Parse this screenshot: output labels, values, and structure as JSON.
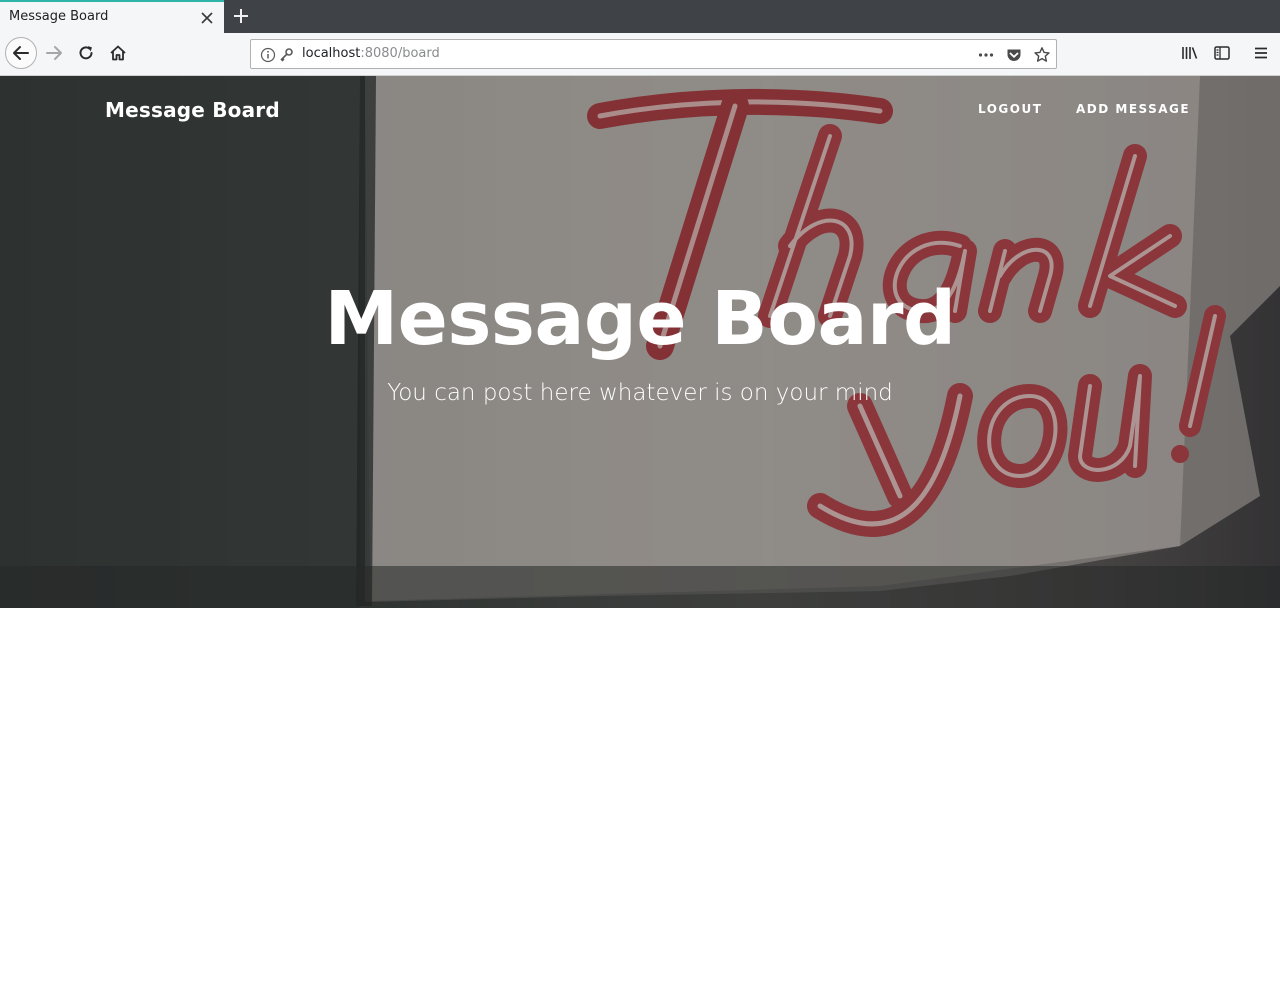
{
  "browser": {
    "tab": {
      "title": "Message Board"
    },
    "url": {
      "host": "localhost",
      "rest": ":8080/board"
    }
  },
  "site": {
    "brand": "Message Board",
    "nav": [
      {
        "label": "LOGOUT"
      },
      {
        "label": "ADD MESSAGE"
      }
    ]
  },
  "hero": {
    "title": "Message Board",
    "subtitle": "You can post here whatever is on your mind",
    "background_sign_text": "Thank you!"
  },
  "colors": {
    "tab_accent": "#2fb5a8",
    "tabstrip": "#3f4246",
    "toolbar": "#f5f6f7",
    "neon_red": "#c8494c",
    "text_white": "#ffffff"
  }
}
